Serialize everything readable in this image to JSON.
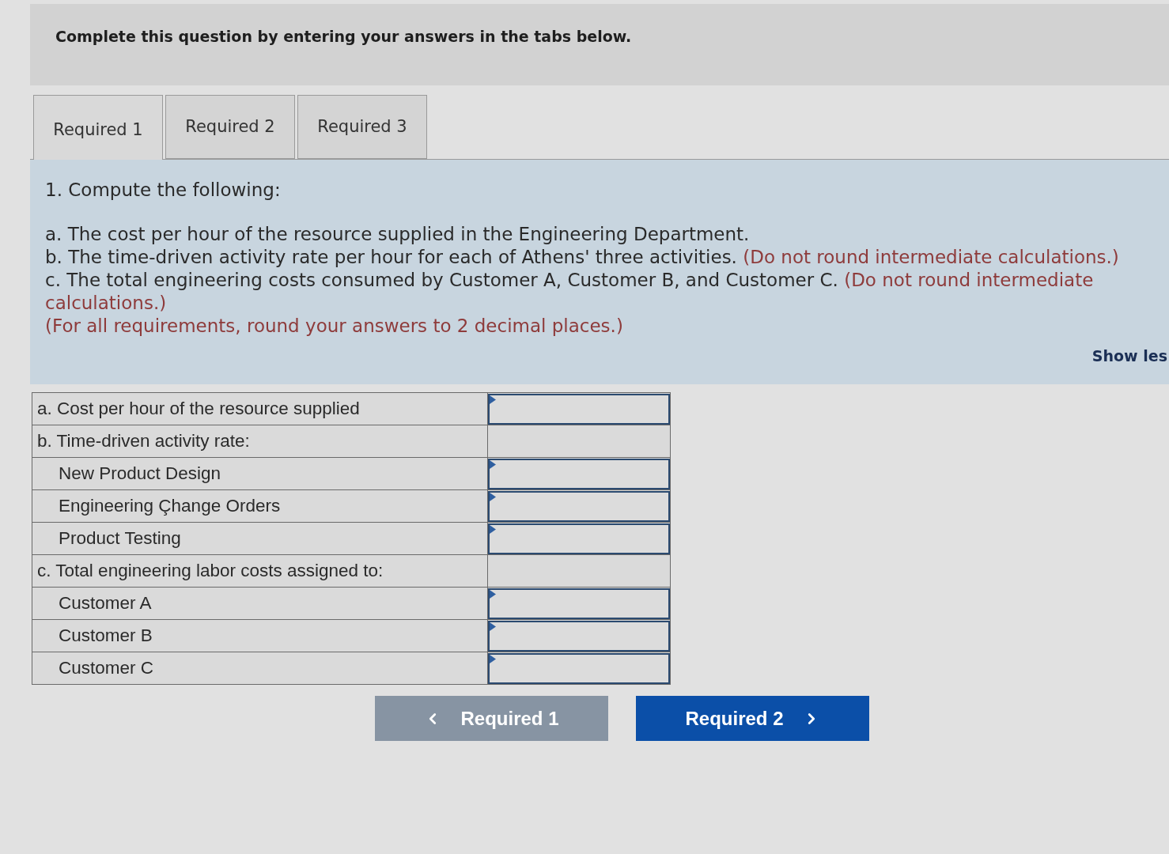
{
  "header": {
    "title": "Complete this question by entering your answers in the tabs below."
  },
  "tabs": [
    {
      "label": "Required 1",
      "selected": true
    },
    {
      "label": "Required 2",
      "selected": false
    },
    {
      "label": "Required 3",
      "selected": false
    }
  ],
  "instructions": {
    "heading": "1. Compute the following:",
    "items": [
      {
        "text": "a. The cost per hour of the resource supplied in the Engineering Department."
      },
      {
        "text": "b. The time-driven activity rate per hour for each of Athens' three activities.",
        "note": "(Do not round intermediate calculations.)"
      },
      {
        "text": "c. The total engineering costs consumed by Customer A, Customer B, and Customer C.",
        "note": "(Do not round intermediate calculations.)"
      },
      {
        "note": "(For all requirements, round your answers to 2 decimal places.)"
      }
    ],
    "toggle_link": "Show les"
  },
  "table": {
    "rows": [
      {
        "kind": "input",
        "label": "a. Cost per hour of the resource supplied"
      },
      {
        "kind": "group",
        "label": "b. Time-driven activity rate:",
        "children": [
          {
            "label": "New Product Design"
          },
          {
            "label": "Engineering Çhange Orders"
          },
          {
            "label": "Product Testing"
          }
        ]
      },
      {
        "kind": "group",
        "label": "c. Total engineering labor costs assigned to:",
        "children": [
          {
            "label": "Customer A"
          },
          {
            "label": "Customer B"
          },
          {
            "label": "Customer C"
          }
        ]
      }
    ]
  },
  "navigation": [
    {
      "kind": "previous",
      "label": "Required 1",
      "disabled": true
    },
    {
      "kind": "next",
      "label": "Required 2",
      "disabled": false
    }
  ]
}
